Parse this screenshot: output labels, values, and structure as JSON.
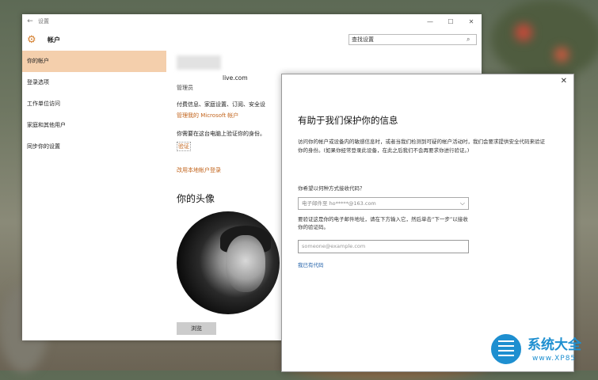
{
  "window": {
    "title": "设置",
    "back_icon": "back-arrow-icon",
    "minimize": "—",
    "maximize": "☐",
    "close": "✕"
  },
  "header": {
    "section_title": "帐户",
    "search_label": "查找设置"
  },
  "sidebar": {
    "items": [
      {
        "label": "你的帐户",
        "active": true
      },
      {
        "label": "登录选项",
        "active": false
      },
      {
        "label": "工作单位访问",
        "active": false
      },
      {
        "label": "家庭和其他用户",
        "active": false
      },
      {
        "label": "同步你的设置",
        "active": false
      }
    ]
  },
  "account": {
    "email_suffix": "live.com",
    "role": "管理员",
    "info_line": "付费信息、家庭设置、订阅、安全设",
    "manage_link": "管理我的 Microsoft 帐户",
    "verify_text": "你需要在这台电脑上验证你的身份。",
    "verify_link": "验证",
    "local_login_link": "改用本地帐户登录",
    "avatar_title": "你的头像",
    "browse_button": "浏览"
  },
  "dialog": {
    "close": "✕",
    "title": "有助于我们保护你的信息",
    "description": "访问你的帐户或设备内的敏感信息时，或者当我们检测到可疑的帐户活动时，我们会要求提供安全代码来验证你的身份。(如果你经常登录此设备，在此之后我们不会再要求你进行验证。)",
    "question": "你希望以何种方式接收代码？",
    "select_value": "电子邮件至 ho*****@163.com",
    "instruction": "要验证这是你的电子邮件地址，请在下方输入它，然后单击“下一步”以接收你的验证码。",
    "email_placeholder": "someone@example.com",
    "have_code_link": "我已有代码"
  },
  "watermark": {
    "brand": "系统大全",
    "url": "www.XP85"
  },
  "colors": {
    "accent": "#d47f2e",
    "link_orange": "#c2641c",
    "nav_active": "#f4cfac",
    "link_blue": "#1f5fa8"
  }
}
